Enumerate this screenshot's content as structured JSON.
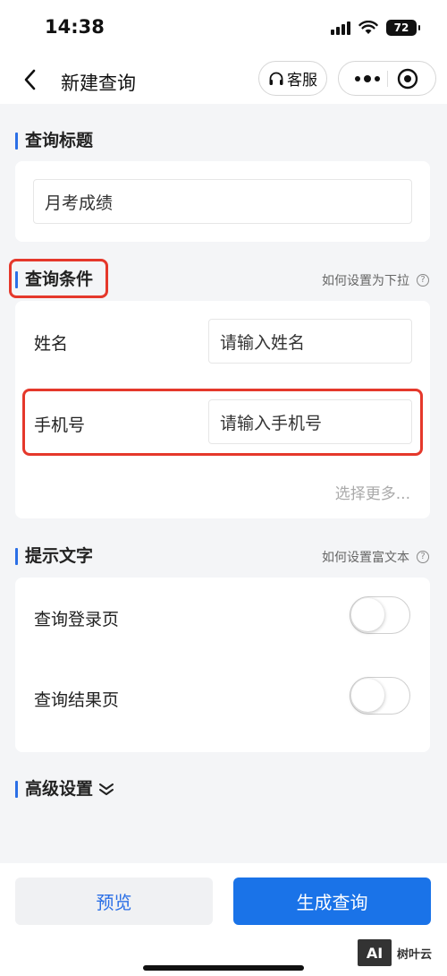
{
  "status": {
    "time": "14:38",
    "battery": "72"
  },
  "nav": {
    "title": "新建查询",
    "service_label": "客服"
  },
  "query_title": {
    "heading": "查询标题",
    "value": "月考成绩"
  },
  "conditions": {
    "heading": "查询条件",
    "hint": "如何设置为下拉",
    "hint_icon": "?",
    "fields": [
      {
        "label": "姓名",
        "placeholder": "请输入姓名"
      },
      {
        "label": "手机号",
        "placeholder": "请输入手机号"
      }
    ],
    "select_more": "选择更多..."
  },
  "tips": {
    "heading": "提示文字",
    "hint": "如何设置富文本",
    "hint_icon": "?",
    "items": [
      {
        "label": "查询登录页",
        "enabled": false
      },
      {
        "label": "查询结果页",
        "enabled": false
      }
    ]
  },
  "advanced": {
    "heading": "高级设置"
  },
  "actions": {
    "preview_label": "预览",
    "generate_label": "生成查询"
  },
  "watermark": {
    "text": "树叶云",
    "badge": "AI"
  },
  "colors": {
    "accent": "#1a73e8",
    "highlight": "#e5382b"
  }
}
